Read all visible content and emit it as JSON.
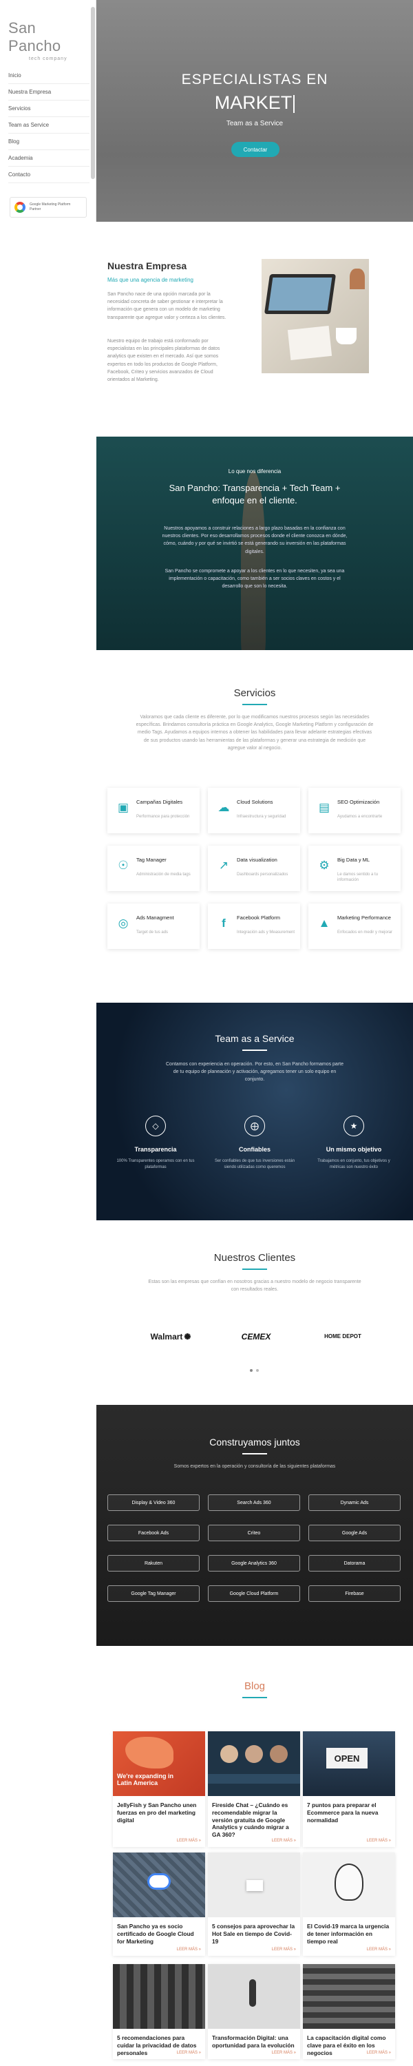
{
  "sidebar": {
    "brand": "San Pancho",
    "brand_tagline": "tech company",
    "nav": [
      "Inicio",
      "Nuestra Empresa",
      "Servicios",
      "Team as Service",
      "Blog",
      "Academia",
      "Contacto"
    ],
    "badge_line1": "Google Marketing Platform",
    "badge_line2": "Partner"
  },
  "hero": {
    "title": "ESPECIALISTAS EN",
    "rotating_word": "MARKET",
    "tagline": "Team as a Service",
    "cta": "Contactar",
    "accent": "#21a9b4"
  },
  "empresa": {
    "title": "Nuestra Empresa",
    "subtitle": "Más que una agencia de marketing",
    "p1": "San Pancho nace de una opción marcada por la necesidad concreta de saber gestionar e interpretar la información que genera con un modelo de marketing transparente que agregue valor y certeza a los clientes.",
    "p2": "Nuestro equipo de trabajo está conformado por especialistas en las principales plataformas de datos analytics que existen en el mercado. Así que somos expertos en todo los productos de Google Platform, Facebook, Criteo y servicios avanzados de Cloud orientados al Marketing."
  },
  "diferencia": {
    "kicker": "Lo que nos diferencia",
    "title": "San Pancho: Transparencia + Tech Team + enfoque en el cliente.",
    "p1": "Nuestros apoyamos a construir relaciones a largo plazo basadas en la confianza con nuestros clientes. Por eso desarrollamos procesos donde el cliente conozca en dónde, cómo, cuándo y por qué se invirtió se está generando su inversión en las plataformas digitales.",
    "p2": "San Pancho se compromete a apoyar a los clientes en lo que necesiten, ya sea una implementación o capacitación, como también a ser socios claves en costos y el desarrollo que son lo necesita."
  },
  "servicios": {
    "title": "Servicios",
    "description": "Valoramos que cada cliente es diferente, por lo que modificamos nuestros procesos según las necesidades específicas. Brindamos consultoría práctica en Google Analytics, Google Marketing Platform y configuración de medio Tags. Ayudamos a equipos internos a obtener las habilidades para llevar adelante estrategias efectivas de sus productos usando las herramientas de las plataformas y generar una estrategia de medición que agregue valor al negocio.",
    "items": [
      {
        "name": "Campañas Digitales",
        "desc": "Performance para protección",
        "icon": "screen-icon"
      },
      {
        "name": "Cloud Solutions",
        "desc": "Infraestructura y seguridad",
        "icon": "cloud-icon"
      },
      {
        "name": "SEO Optimización",
        "desc": "Ayudamos a encontrarte",
        "icon": "document-icon"
      },
      {
        "name": "Tag Manager",
        "desc": "Administración de media tags",
        "icon": "tag-icon"
      },
      {
        "name": "Data visualization",
        "desc": "Dashboards personalizados",
        "icon": "chart-icon"
      },
      {
        "name": "Big Data y ML",
        "desc": "Le damos sentido a tu información",
        "icon": "gear-icon"
      },
      {
        "name": "Ads Managment",
        "desc": "Target de tus ads",
        "icon": "target-icon"
      },
      {
        "name": "Facebook Platform",
        "desc": "Integración ads y Measurement",
        "icon": "facebook-icon"
      },
      {
        "name": "Marketing Performance",
        "desc": "Enfocados en medir y mejorar",
        "icon": "megaphone-icon"
      }
    ]
  },
  "team": {
    "title": "Team as a Service",
    "description": "Contamos con experiencia en operación. Por esto, en San Pancho formamos parte de tu equipo de planeación y activación, agregamos tener un solo equipo en conjunto.",
    "cols": [
      {
        "name": "Transparencia",
        "desc": "100% Transparentes operamos con en tus plataformas",
        "icon": "diamond-icon"
      },
      {
        "name": "Confiables",
        "desc": "Ser confiables de que tus inversiones están siendo utilizadas como queremos",
        "icon": "compass-icon"
      },
      {
        "name": "Un mismo objetivo",
        "desc": "Trabajamos en conjunto, tus objetivos y métricas son nuestro éxito",
        "icon": "trophy-icon"
      }
    ]
  },
  "clientes": {
    "title": "Nuestros Clientes",
    "description": "Estas son las empresas que confían en nosotros gracias a nuestro modelo de negocio transparente con resultados reales.",
    "logos": [
      "Walmart",
      "CEMEX",
      "HOME DEPOT"
    ]
  },
  "construyamos": {
    "title": "Construyamos juntos",
    "description": "Somos expertos en la operación y consultoría de las siguientes plataformas",
    "platforms": [
      "Display & Video 360",
      "Search Ads 360",
      "Dynamic Ads",
      "Facebook Ads",
      "Criteo",
      "Google Ads",
      "Rakuten",
      "Google Analytics 360",
      "Datorama",
      "Google Tag Manager",
      "Google Cloud Platform",
      "Firebase"
    ]
  },
  "blog": {
    "title": "Blog",
    "read_more": "LEER MÁS »",
    "posts": [
      {
        "title": "JellyFish y San Pancho unen fuerzas en pro del marketing digital",
        "thumb_text": "We're expanding in Latin America"
      },
      {
        "title": "Fireside Chat – ¿Cuándo es recomendable migrar la versión gratuita de Google Analytics y cuándo migrar a GA 360?",
        "thumb_text": ""
      },
      {
        "title": "7 puntos para preparar el Ecommerce para la nueva normalidad",
        "thumb_text": "OPEN"
      },
      {
        "title": "San Pancho ya es socio certificado de Google Cloud for Marketing",
        "thumb_text": ""
      },
      {
        "title": "5 consejos para aprovechar la Hot Sale en tiempo de Covid-19",
        "thumb_text": ""
      },
      {
        "title": "El Covid-19 marca la urgencia de tener información en tiempo real",
        "thumb_text": ""
      },
      {
        "title": "5 recomendaciones para cuidar la privacidad de datos personales",
        "thumb_text": ""
      },
      {
        "title": "Transformación Digital: una oportunidad para la evolución",
        "thumb_text": ""
      },
      {
        "title": "La capacitación digital como clave para el éxito en los negocios",
        "thumb_text": ""
      }
    ]
  }
}
